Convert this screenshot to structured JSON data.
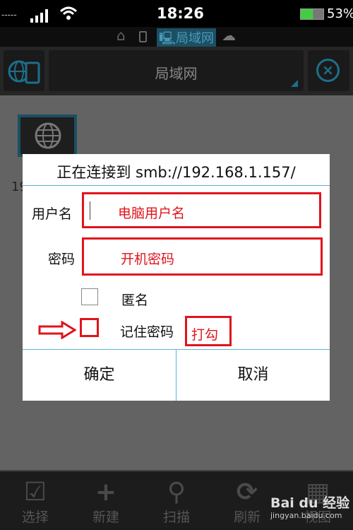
{
  "status_bar": {
    "time": "18:26",
    "battery": "53%",
    "signal_icon": "signal-icon",
    "wifi_icon": "wifi-icon"
  },
  "breadcrumb": {
    "items": [
      {
        "icon": "home-icon"
      },
      {
        "icon": "phone-icon"
      },
      {
        "icon": "lan-icon",
        "label": "局域网",
        "active": true
      },
      {
        "icon": "cloud-icon"
      }
    ]
  },
  "toolbar": {
    "title": "局域网",
    "accent": "#1c6f8c"
  },
  "content": {
    "item_label": "19"
  },
  "dialog": {
    "title": "正在连接到 smb://192.168.1.157/",
    "username_label": "用户名",
    "username_value": "",
    "username_annotation": "电脑用户名",
    "password_label": "密码",
    "password_value": "",
    "password_annotation": "开机密码",
    "anonymous_label": "匿名",
    "anonymous_checked": false,
    "remember_label": "记住密码",
    "remember_checked": false,
    "remember_annotation": "打勾",
    "ok": "确定",
    "cancel": "取消",
    "annotation_color": "#e0141c"
  },
  "bottom_bar": {
    "items": [
      {
        "label": "选择",
        "icon": "select-icon"
      },
      {
        "label": "新建",
        "icon": "plus-icon"
      },
      {
        "label": "扫描",
        "icon": "search-icon"
      },
      {
        "label": "刷新",
        "icon": "refresh-icon"
      },
      {
        "label": "视图",
        "icon": "grid-icon"
      }
    ]
  },
  "watermark": {
    "text": "Bai du 经验",
    "url": "jingyan.baidu.com"
  }
}
